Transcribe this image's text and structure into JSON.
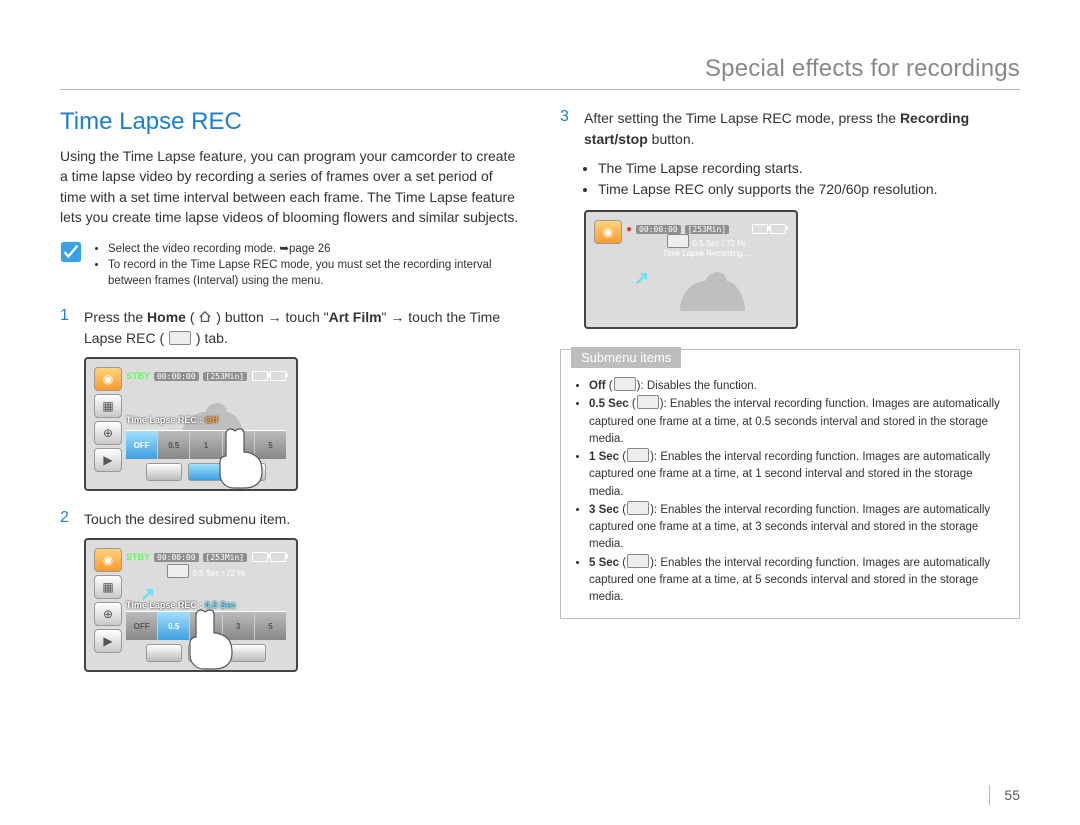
{
  "header": {
    "section_title": "Special effects for recordings"
  },
  "feature": {
    "title": "Time Lapse REC"
  },
  "intro": "Using the Time Lapse feature, you can program your camcorder to create a time lapse video by recording a series of frames over a set period of time with a set time interval between each frame. The Time Lapse feature lets you create time lapse videos of blooming flowers and similar subjects.",
  "note": {
    "items": [
      "Select the video recording mode. ➥page 26",
      "To record in the Time Lapse REC mode, you must set the recording interval between frames (Interval) using the menu."
    ]
  },
  "steps": {
    "s1_num": "1",
    "s1_a": "Press the ",
    "s1_b": "Home",
    "s1_c": " ( ",
    "s1_d": " ) button → touch \"",
    "s1_e": "Art Film",
    "s1_f": "\" → touch the Time Lapse REC ( ",
    "s1_g": " ) tab.",
    "s2_num": "2",
    "s2_text": "Touch the desired submenu item.",
    "s3_num": "3",
    "s3_a": "After setting the Time Lapse REC mode, press the ",
    "s3_b": "Recording start/stop",
    "s3_c": " button.",
    "s3_bullets": [
      "The Time Lapse recording starts.",
      "Time Lapse REC only supports the 720/60p resolution."
    ]
  },
  "lcd1": {
    "stby": "STBY",
    "time": "00:00:00",
    "remain": "[253Min]",
    "label": "Time Lapse REC :",
    "value": "Off",
    "row": [
      "OFF",
      "0.5",
      "1",
      "3",
      "5"
    ]
  },
  "lcd2": {
    "stby": "STBY",
    "time": "00:00:00",
    "remain": "[253Min]",
    "info_line": "0.5 Sec / 72 Hr",
    "label": "Time Lapse REC :",
    "value": "0.5 Sec",
    "row": [
      "OFF",
      "0.5",
      "1",
      "3",
      "5"
    ]
  },
  "lcd3": {
    "time": "00:00:00",
    "remain": "[253Min]",
    "info_line": "0.5 Sec / 72 Hr",
    "caption": "Time Lapse Recording..."
  },
  "submenu": {
    "title": "Submenu items",
    "off_label": "Off",
    "off_desc": "Disables the function.",
    "i05_label": "0.5 Sec",
    "i05_desc": "Enables the interval recording function. Images are automatically captured one frame at a time, at 0.5 seconds interval and stored in the storage media.",
    "i1_label": "1 Sec",
    "i1_desc": "Enables the interval recording function. Images are automatically captured one frame at a time, at 1 second interval and stored in the storage media.",
    "i3_label": "3 Sec",
    "i3_desc": "Enables the interval recording function. Images are automatically captured one frame at a time, at 3 seconds interval and stored in the storage media.",
    "i5_label": "5 Sec",
    "i5_desc": "Enables the interval recording function. Images are automatically captured one frame at a time, at 5 seconds interval and stored in the storage media."
  },
  "page_number": "55"
}
